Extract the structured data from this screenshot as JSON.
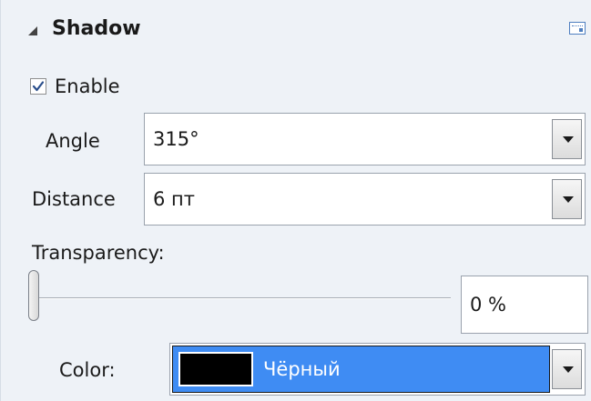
{
  "shadow": {
    "title": "Shadow",
    "enable": {
      "label": "Enable",
      "checked": true
    },
    "angle": {
      "label": "Angle",
      "value": "315°"
    },
    "distance": {
      "label": "Distance",
      "value": "6 пт"
    },
    "transparency": {
      "label": "Transparency:",
      "value": "0 %",
      "level": 0
    },
    "color": {
      "label": "Color:",
      "value": "Чёрный",
      "swatch": "#000000",
      "highlight": "#3f8cf3"
    }
  },
  "icons": {
    "collapse": "collapse-triangle-icon",
    "more_options": "more-options-icon",
    "dropdown": "chevron-down-icon"
  }
}
